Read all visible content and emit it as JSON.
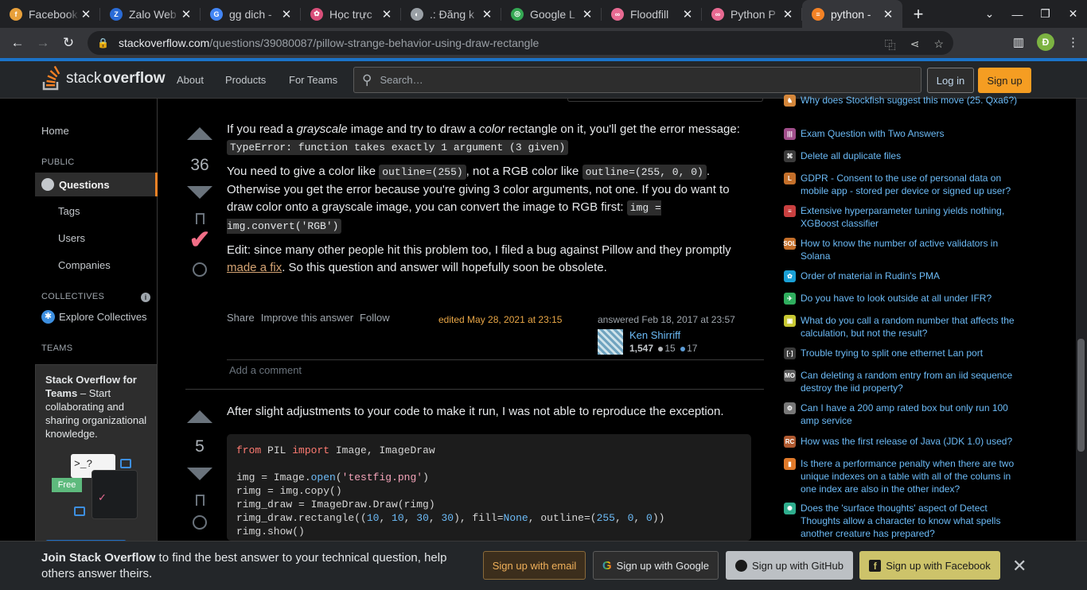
{
  "browser": {
    "tabs": [
      {
        "title": "Facebook",
        "color": "#e8a03a",
        "glyph": "f"
      },
      {
        "title": "Zalo Web",
        "color": "#2a6bd6",
        "glyph": "Z"
      },
      {
        "title": "gg dich -",
        "color": "#4285f4",
        "glyph": "G"
      },
      {
        "title": "Học trực",
        "color": "#d94f7a",
        "glyph": "✿"
      },
      {
        "title": ".: Đăng k",
        "color": "#9aa0a6",
        "glyph": "◐"
      },
      {
        "title": "Google L",
        "color": "#34a853",
        "glyph": "◎"
      },
      {
        "title": "Floodfill",
        "color": "#e86a92",
        "glyph": "∞"
      },
      {
        "title": "Python P",
        "color": "#e86a92",
        "glyph": "∞"
      },
      {
        "title": "python - ",
        "color": "#f48225",
        "glyph": "≡"
      }
    ],
    "url_host": "stackoverflow.com",
    "url_path": "/questions/39080087/pillow-strange-behavior-using-draw-rectangle",
    "profile_initial": "Đ"
  },
  "header": {
    "logo_light": "stack",
    "logo_bold": "overflow",
    "nav": [
      "About",
      "Products",
      "For Teams"
    ],
    "search_placeholder": "Search…",
    "login": "Log in",
    "signup": "Sign up"
  },
  "leftnav": {
    "home": "Home",
    "public": "PUBLIC",
    "questions": "Questions",
    "tags": "Tags",
    "users": "Users",
    "companies": "Companies",
    "collectives": "COLLECTIVES",
    "explore": "Explore Collectives",
    "teams": "TEAMS",
    "teams_title": "Stack Overflow for Teams",
    "teams_desc": " – Start collaborating and sharing organizational knowledge.",
    "art_prompt": ">_?",
    "art_free": "Free"
  },
  "answer1": {
    "score": "36",
    "p1_a": "If you read a ",
    "p1_em1": "grayscale",
    "p1_b": " image and try to draw a ",
    "p1_em2": "color",
    "p1_c": " rectangle on it, you'll get the error message:",
    "p1_code": "TypeError: function takes exactly 1 argument (3 given)",
    "p2_a": "You need to give a color like ",
    "p2_code1": "outline=(255)",
    "p2_b": ", not a RGB color like ",
    "p2_code2": "outline=(255, 0, 0)",
    "p2_c": ". Otherwise you get the error because you're giving 3 color arguments, not one. If you do want to draw color onto a grayscale image, you can convert the image to RGB first: ",
    "p2_code3": "img = img.convert('RGB')",
    "p3_a": "Edit: since many other people hit this problem too, I filed a bug against Pillow and they promptly ",
    "p3_link": "made a fix",
    "p3_b": ". So this question and answer will hopefully soon be obsolete.",
    "menu": [
      "Share",
      "Improve this answer",
      "Follow"
    ],
    "edited": "edited May 28, 2021 at 23:15",
    "answered": "answered Feb 18, 2017 at 23:57",
    "user": "Ken Shirriff",
    "rep": "1,547",
    "silver": "15",
    "bronze": "17",
    "add_comment": "Add a comment"
  },
  "answer2": {
    "score": "5",
    "text": "After slight adjustments to your code to make it run, I was not able to reproduce the exception."
  },
  "code": {
    "l1_kw1": "from",
    "l1_a": " PIL ",
    "l1_kw2": "import",
    "l1_b": " Image, ImageDraw",
    "l3_a": "img = Image.",
    "l3_fn": "open",
    "l3_b": "(",
    "l3_str": "'testfig.png'",
    "l3_c": ")",
    "l4": "rimg = img.copy()",
    "l5": "rimg_draw = ImageDraw.Draw(rimg)",
    "l6_a": "rimg_draw.rectangle((",
    "l6_n1": "10",
    "l6_s1": ", ",
    "l6_n2": "10",
    "l6_s2": ", ",
    "l6_n3": "30",
    "l6_s3": ", ",
    "l6_n4": "30",
    "l6_b": "), fill=",
    "l6_none": "None",
    "l6_c": ", outline=(",
    "l6_n5": "255",
    "l6_s4": ", ",
    "l6_n6": "0",
    "l6_s5": ", ",
    "l6_n7": "0",
    "l6_d": "))",
    "l7": "rimg.show()"
  },
  "hot_questions": [
    {
      "text": "Why does Stockfish suggest this move (25. Qxa6?)",
      "color": "#d4863a",
      "glyph": "♞"
    },
    {
      "text": "Exam Question with Two Answers",
      "color": "#a04d8a",
      "glyph": "|||"
    },
    {
      "text": "Delete all duplicate files",
      "color": "#3b3b3b",
      "glyph": "⌘"
    },
    {
      "text": "GDPR - Consent to the use of personal data on mobile app - stored per device or signed up user?",
      "color": "#c46f2a",
      "glyph": "L"
    },
    {
      "text": "Extensive hyperparameter tuning yields nothing, XGBoost classifier",
      "color": "#c94040",
      "glyph": "≡"
    },
    {
      "text": "How to know the number of active validators in Solana",
      "color": "#c46f2a",
      "glyph": "SOL"
    },
    {
      "text": "Order of material in Rudin's PMA",
      "color": "#1aa0d6",
      "glyph": "✿"
    },
    {
      "text": "Do you have to look outside at all under IFR?",
      "color": "#2fae5e",
      "glyph": "✈"
    },
    {
      "text": "What do you call a random number that affects the calculation, but not the result?",
      "color": "#c8c832",
      "glyph": "▣"
    },
    {
      "text": "Trouble trying to split one ethernet Lan port",
      "color": "#3b3b3b",
      "glyph": "[·]"
    },
    {
      "text": "Can deleting a random entry from an iid sequence destroy the iid property?",
      "color": "#5b5b5b",
      "glyph": "MO"
    },
    {
      "text": "Can I have a 200 amp rated box but only run 100 amp service",
      "color": "#777777",
      "glyph": "⚙"
    },
    {
      "text": "How was the first release of Java (JDK 1.0) used?",
      "color": "#b05a30",
      "glyph": "RC"
    },
    {
      "text": "Is there a performance penalty when there are two unique indexes on a table with all of the colums in one index are also in the other index?",
      "color": "#e07a2a",
      "glyph": "▮"
    },
    {
      "text": "Does the 'surface thoughts' aspect of Detect Thoughts allow a character to know what spells another creature has prepared?",
      "color": "#2fae8e",
      "glyph": "✺"
    }
  ],
  "banner": {
    "bold": "Join Stack Overflow",
    "text": " to find the best answer to your technical question, help others answer theirs.",
    "email": "Sign up with email",
    "google": "Sign up with Google",
    "github": "Sign up with GitHub",
    "facebook": "Sign up with Facebook"
  }
}
